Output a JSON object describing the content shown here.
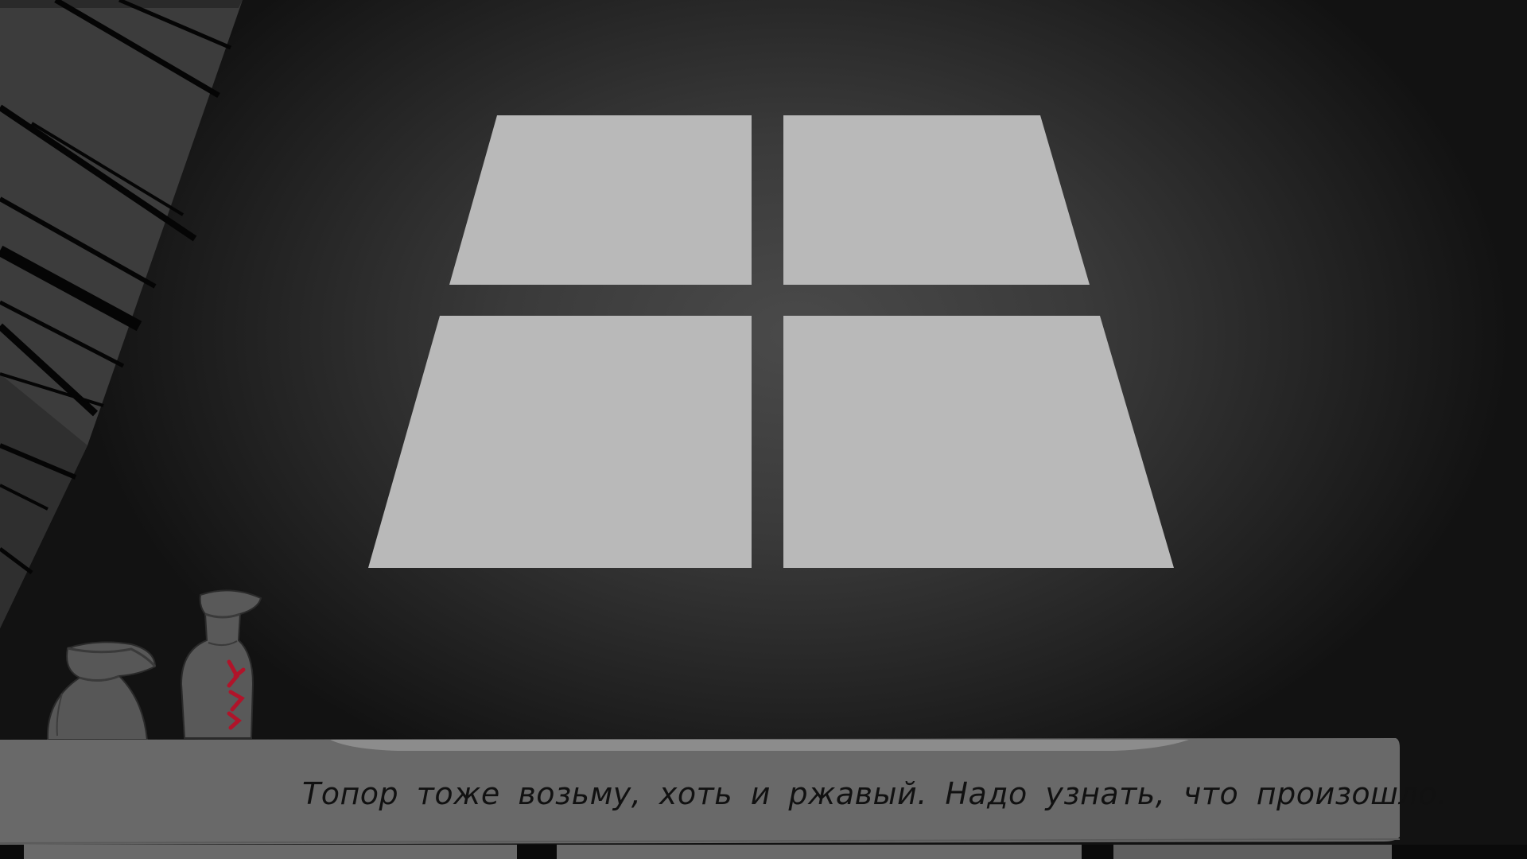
{
  "scene": {
    "name": "attic-room",
    "colors": {
      "window_light": "#b8b8b8",
      "shelf": "#6a6a6a",
      "jar_body": "#555555",
      "jar_symbol": "#b0142a",
      "rafters": "#3a3a3a",
      "rafter_lines": "#050505"
    },
    "props": [
      "round-jar",
      "tall-bottle-with-red-rune",
      "shelf",
      "window-light",
      "roof-rafters"
    ]
  },
  "dialogue": {
    "text": "Топор тоже возьму, хоть и ржавый. Надо узнать, что произошло."
  }
}
